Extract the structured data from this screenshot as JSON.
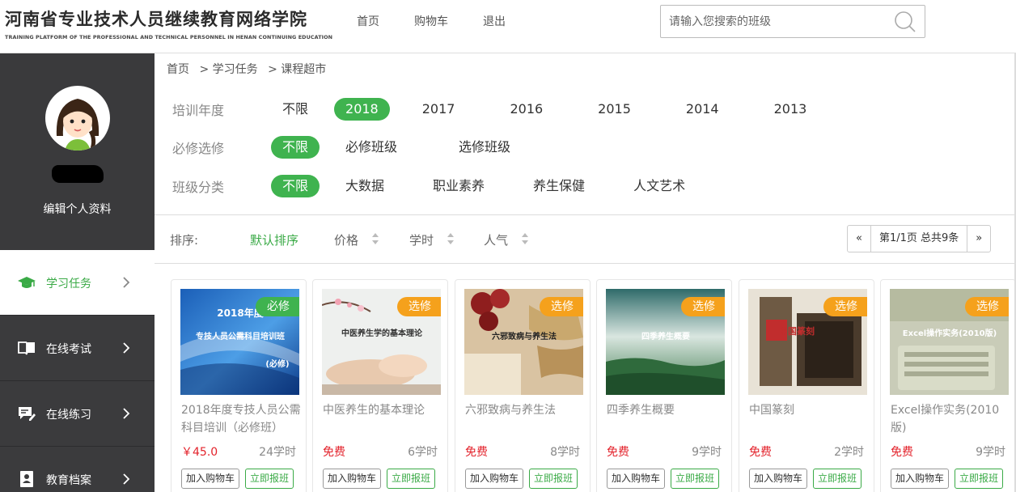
{
  "header": {
    "logo_cn": "河南省专业技术人员继续教育网络学院",
    "logo_en": "TRAINING PLATFORM OF THE PROFESSIONAL AND TECHNICAL PERSONNEL IN HENAN CONTINUING EDUCATION",
    "nav": [
      "首页",
      "购物车",
      "退出"
    ],
    "search_placeholder": "请输入您搜索的班级"
  },
  "sidebar": {
    "edit_profile": "编辑个人资料",
    "menu": [
      {
        "label": "学习任务",
        "icon": "graduation-cap-icon",
        "active": true
      },
      {
        "label": "在线考试",
        "icon": "book-icon",
        "active": false
      },
      {
        "label": "在线练习",
        "icon": "chat-edit-icon",
        "active": false
      },
      {
        "label": "教育档案",
        "icon": "profile-card-icon",
        "active": false
      }
    ]
  },
  "breadcrumb": [
    "首页",
    "> 学习任务",
    "> 课程超市"
  ],
  "filters": {
    "year": {
      "label": "培训年度",
      "options": [
        "不限",
        "2018",
        "2017",
        "2016",
        "2015",
        "2014",
        "2013"
      ],
      "selected": 1
    },
    "required": {
      "label": "必修选修",
      "options": [
        "不限",
        "必修班级",
        "选修班级"
      ],
      "selected": 0
    },
    "category": {
      "label": "班级分类",
      "options": [
        "不限",
        "大数据",
        "职业素养",
        "养生保健",
        "人文艺术"
      ],
      "selected": 0
    }
  },
  "sort": {
    "label": "排序:",
    "options": [
      "默认排序",
      "价格",
      "学时",
      "人气"
    ],
    "selected": 0
  },
  "pager": {
    "prev": "«",
    "info": "第1/1页 总共9条",
    "next": "»"
  },
  "colors": {
    "accent": "#3fb34f",
    "required_tag": "#3fb34f",
    "elective_tag": "#f5a11c",
    "price": "#e3222b",
    "sidebar": "#3b3b3d"
  },
  "buttons": {
    "cart": "加入购物车",
    "register": "立即报班"
  },
  "courses": [
    {
      "title": "2018年度专技人员公需科目培训（必修班）",
      "tag": "必修",
      "price": "￥45.0",
      "hours": "24学时",
      "thumb_text": [
        "2018年度",
        "专技人员公需科目培训班",
        "(必修)"
      ]
    },
    {
      "title": "中医养生的基本理论",
      "tag": "选修",
      "price": "免费",
      "hours": "6学时",
      "thumb_text": [
        "中医养生学的基本理论"
      ]
    },
    {
      "title": "六邪致病与养生法",
      "tag": "选修",
      "price": "免费",
      "hours": "8学时",
      "thumb_text": [
        "六邪致病与养生法"
      ]
    },
    {
      "title": "四季养生概要",
      "tag": "选修",
      "price": "免费",
      "hours": "9学时",
      "thumb_text": [
        "四季养生概要"
      ]
    },
    {
      "title": "中国篆刻",
      "tag": "选修",
      "price": "免费",
      "hours": "2学时",
      "thumb_text": [
        "中国篆刻"
      ]
    },
    {
      "title": "Excel操作实务(2010版)",
      "tag": "选修",
      "price": "免费",
      "hours": "9学时",
      "thumb_text": [
        "Excel操作实务(2010版)"
      ]
    }
  ]
}
